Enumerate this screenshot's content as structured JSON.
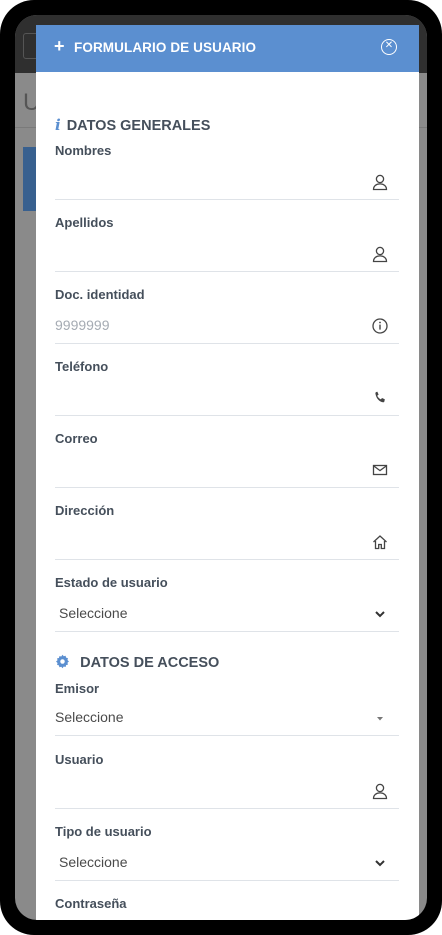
{
  "header": {
    "title": "FORMULARIO DE USUARIO"
  },
  "background": {
    "page_title_initial": "U"
  },
  "sections": {
    "general": "DATOS GENERALES",
    "access": "DATOS DE ACCESO"
  },
  "fields": {
    "nombres": {
      "label": "Nombres",
      "value": "",
      "placeholder": ""
    },
    "apellidos": {
      "label": "Apellidos",
      "value": "",
      "placeholder": ""
    },
    "doc": {
      "label": "Doc. identidad",
      "value": "",
      "placeholder": "9999999"
    },
    "telefono": {
      "label": "Teléfono",
      "value": "",
      "placeholder": ""
    },
    "correo": {
      "label": "Correo",
      "value": "",
      "placeholder": ""
    },
    "direccion": {
      "label": "Dirección",
      "value": "",
      "placeholder": ""
    },
    "estado": {
      "label": "Estado de usuario",
      "selected": "Seleccione"
    },
    "emisor": {
      "label": "Emisor",
      "selected": "Seleccione"
    },
    "usuario": {
      "label": "Usuario",
      "value": "",
      "placeholder": ""
    },
    "tipo": {
      "label": "Tipo de usuario",
      "selected": "Seleccione"
    },
    "contrasena": {
      "label": "Contraseña",
      "value": "",
      "placeholder": ""
    }
  },
  "icons": {
    "header": "plus-icon",
    "close": "close-circle-icon",
    "general": "info-icon",
    "access": "gear-icon",
    "person": "user-icon",
    "info": "info-circle-icon",
    "phone": "phone-icon",
    "mail": "envelope-icon",
    "home": "home-icon",
    "chevron": "chevron-down-icon",
    "caret": "caret-down-icon",
    "lock": "lock-icon"
  },
  "colors": {
    "header_bg": "#5b8fd0",
    "accent": "#5b8fd0",
    "label": "#454f5b"
  }
}
